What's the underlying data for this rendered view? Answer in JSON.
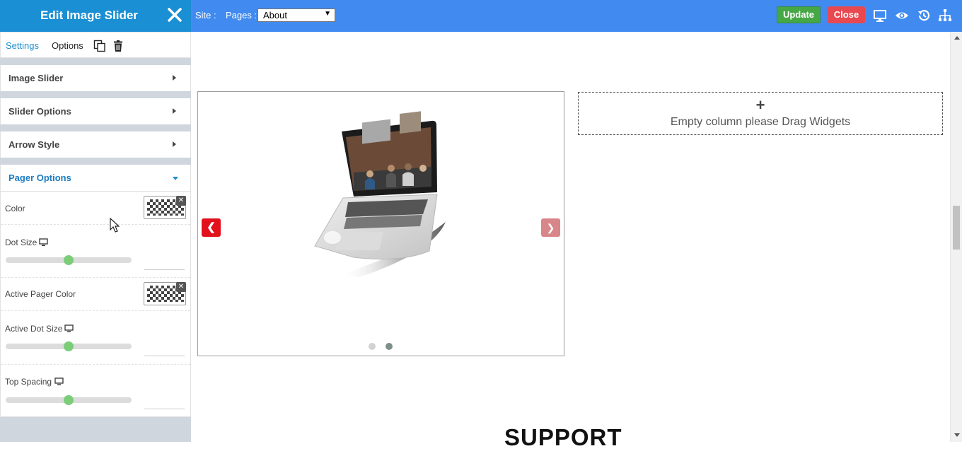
{
  "panel": {
    "title": "Edit Image Slider",
    "tabs": {
      "settings": "Settings",
      "options": "Options"
    },
    "sections": [
      {
        "label": "Image Slider",
        "open": false
      },
      {
        "label": "Slider Options",
        "open": false
      },
      {
        "label": "Arrow Style",
        "open": false
      },
      {
        "label": "Pager Options",
        "open": true
      }
    ],
    "pager": {
      "color_label": "Color",
      "dot_size_label": "Dot Size",
      "dot_size_level": 0.5,
      "active_color_label": "Active Pager Color",
      "active_dot_size_label": "Active Dot Size",
      "active_dot_size_level": 0.5,
      "top_spacing_label": "Top Spacing",
      "top_spacing_level": 0.5
    }
  },
  "toolbar": {
    "site_label": "Site :",
    "pages_label": "Pages :",
    "page_selected": "About",
    "update_label": "Update",
    "close_label": "Close",
    "icons": [
      "desktop-icon",
      "eye-icon",
      "history-icon",
      "sitemap-icon"
    ]
  },
  "canvas": {
    "slider_prev": "❮",
    "slider_next": "❯",
    "dots": 2,
    "active_dot": 1,
    "empty_plus": "+",
    "empty_column_text": "Empty column please Drag Widgets",
    "support_heading": "SUPPORT"
  },
  "colors": {
    "topbar": "#418bf0",
    "panel_header": "#1b8fd3",
    "update": "#46a745",
    "close": "#e8484f",
    "arrow_active": "#e3111b",
    "arrow_inactive": "#d8868a",
    "slider_knob": "#7ccd7a"
  }
}
